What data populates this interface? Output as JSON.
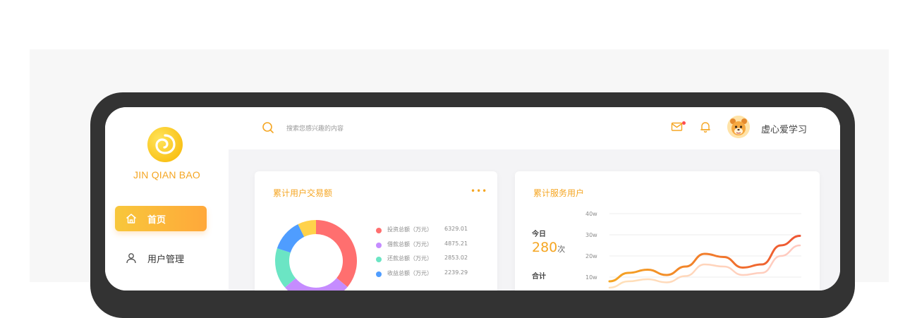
{
  "sidebar": {
    "brand": "JIN QIAN BAO",
    "items": [
      {
        "label": "首页",
        "icon": "home-icon",
        "active": true
      },
      {
        "label": "用户管理",
        "icon": "user-icon",
        "active": false
      }
    ]
  },
  "header": {
    "search": {
      "placeholder": "搜索您感兴趣的内容"
    },
    "icons": [
      "search-icon",
      "mail-icon",
      "bell-icon"
    ],
    "username": "虚心爱学习"
  },
  "colors": {
    "accent": "#f5a623",
    "gradient_start": "#f8c73b",
    "gradient_end": "#ffa83a"
  },
  "cards": {
    "transactions": {
      "title": "累计用户交易额",
      "more": "•••",
      "legend": [
        {
          "label": "投资总额（万元）",
          "value": "6329.01",
          "color": "#ff6f6f"
        },
        {
          "label": "借款总额（万元）",
          "value": "4875.21",
          "color": "#c58cff"
        },
        {
          "label": "还款总额（万元）",
          "value": "2853.02",
          "color": "#6be5c4"
        },
        {
          "label": "收益总额（万元）",
          "value": "2239.29",
          "color": "#4f9dff"
        }
      ]
    },
    "service_users": {
      "title": "累计服务用户",
      "today_label": "今日",
      "today_value": "280",
      "today_unit": "次",
      "total_label": "合计"
    }
  },
  "chart_data": [
    {
      "type": "pie",
      "title": "累计用户交易额",
      "labels": [
        "投资总额（万元）",
        "借款总额（万元）",
        "还款总额（万元）",
        "收益总额（万元）",
        ""
      ],
      "values": [
        6329.01,
        4875.21,
        2853.02,
        2239.29,
        1280
      ],
      "colors": [
        "#ff6f6f",
        "#c58cff",
        "#6be5c4",
        "#4f9dff",
        "#ffd24a"
      ]
    },
    {
      "type": "line",
      "title": "累计服务用户",
      "y_ticks": [
        "40w",
        "30w",
        "20w",
        "10w"
      ],
      "ylim": [
        0,
        40
      ],
      "x": [
        0,
        1,
        2,
        3,
        4,
        5,
        6,
        7,
        8,
        9,
        10
      ],
      "series": [
        {
          "values": [
            8,
            12,
            13.5,
            11,
            15,
            21,
            19.5,
            14.5,
            16,
            25,
            29.5
          ],
          "color_start": "#f5a623",
          "color_end": "#ee5533"
        },
        {
          "values": [
            5,
            8,
            9,
            7.5,
            10.5,
            16,
            15,
            11,
            12,
            20,
            25
          ],
          "color_start": "#ffe1b8",
          "color_end": "#ffc9c0"
        }
      ],
      "grid": true
    }
  ]
}
